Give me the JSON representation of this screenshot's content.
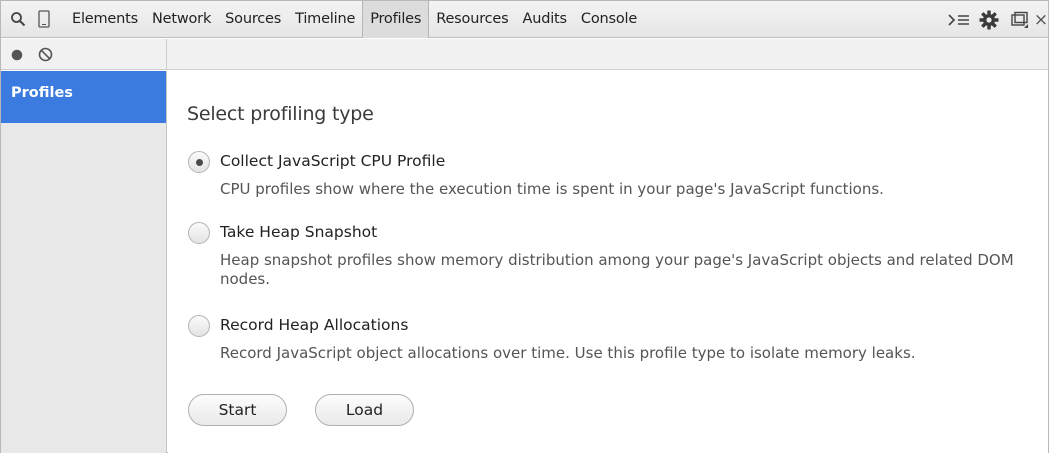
{
  "toolbar": {
    "tabs": [
      {
        "label": "Elements"
      },
      {
        "label": "Network"
      },
      {
        "label": "Sources"
      },
      {
        "label": "Timeline"
      },
      {
        "label": "Profiles",
        "selected": true
      },
      {
        "label": "Resources"
      },
      {
        "label": "Audits"
      },
      {
        "label": "Console"
      }
    ],
    "icons": {
      "search": "search-icon",
      "device": "device-mode-icon",
      "drawer": "show-drawer-icon",
      "settings": "gear-icon",
      "dock": "dock-side-icon",
      "close": "close-icon"
    },
    "close_glyph": "×"
  },
  "statusbar": {
    "record": "record-icon",
    "clear": "clear-icon"
  },
  "sidebar": {
    "items": [
      {
        "label": "Profiles",
        "selected": true
      }
    ]
  },
  "main": {
    "title": "Select profiling type",
    "options": [
      {
        "label": "Collect JavaScript CPU Profile",
        "description": "CPU profiles show where the execution time is spent in your page's JavaScript functions.",
        "checked": true
      },
      {
        "label": "Take Heap Snapshot",
        "description": "Heap snapshot profiles show memory distribution among your page's JavaScript objects and related DOM nodes.",
        "checked": false
      },
      {
        "label": "Record Heap Allocations",
        "description": "Record JavaScript object allocations over time. Use this profile type to isolate memory leaks.",
        "checked": false
      }
    ],
    "buttons": {
      "start": "Start",
      "load": "Load"
    }
  },
  "colors": {
    "sidebar_selected": "#3b7be0",
    "record": "#555555"
  }
}
